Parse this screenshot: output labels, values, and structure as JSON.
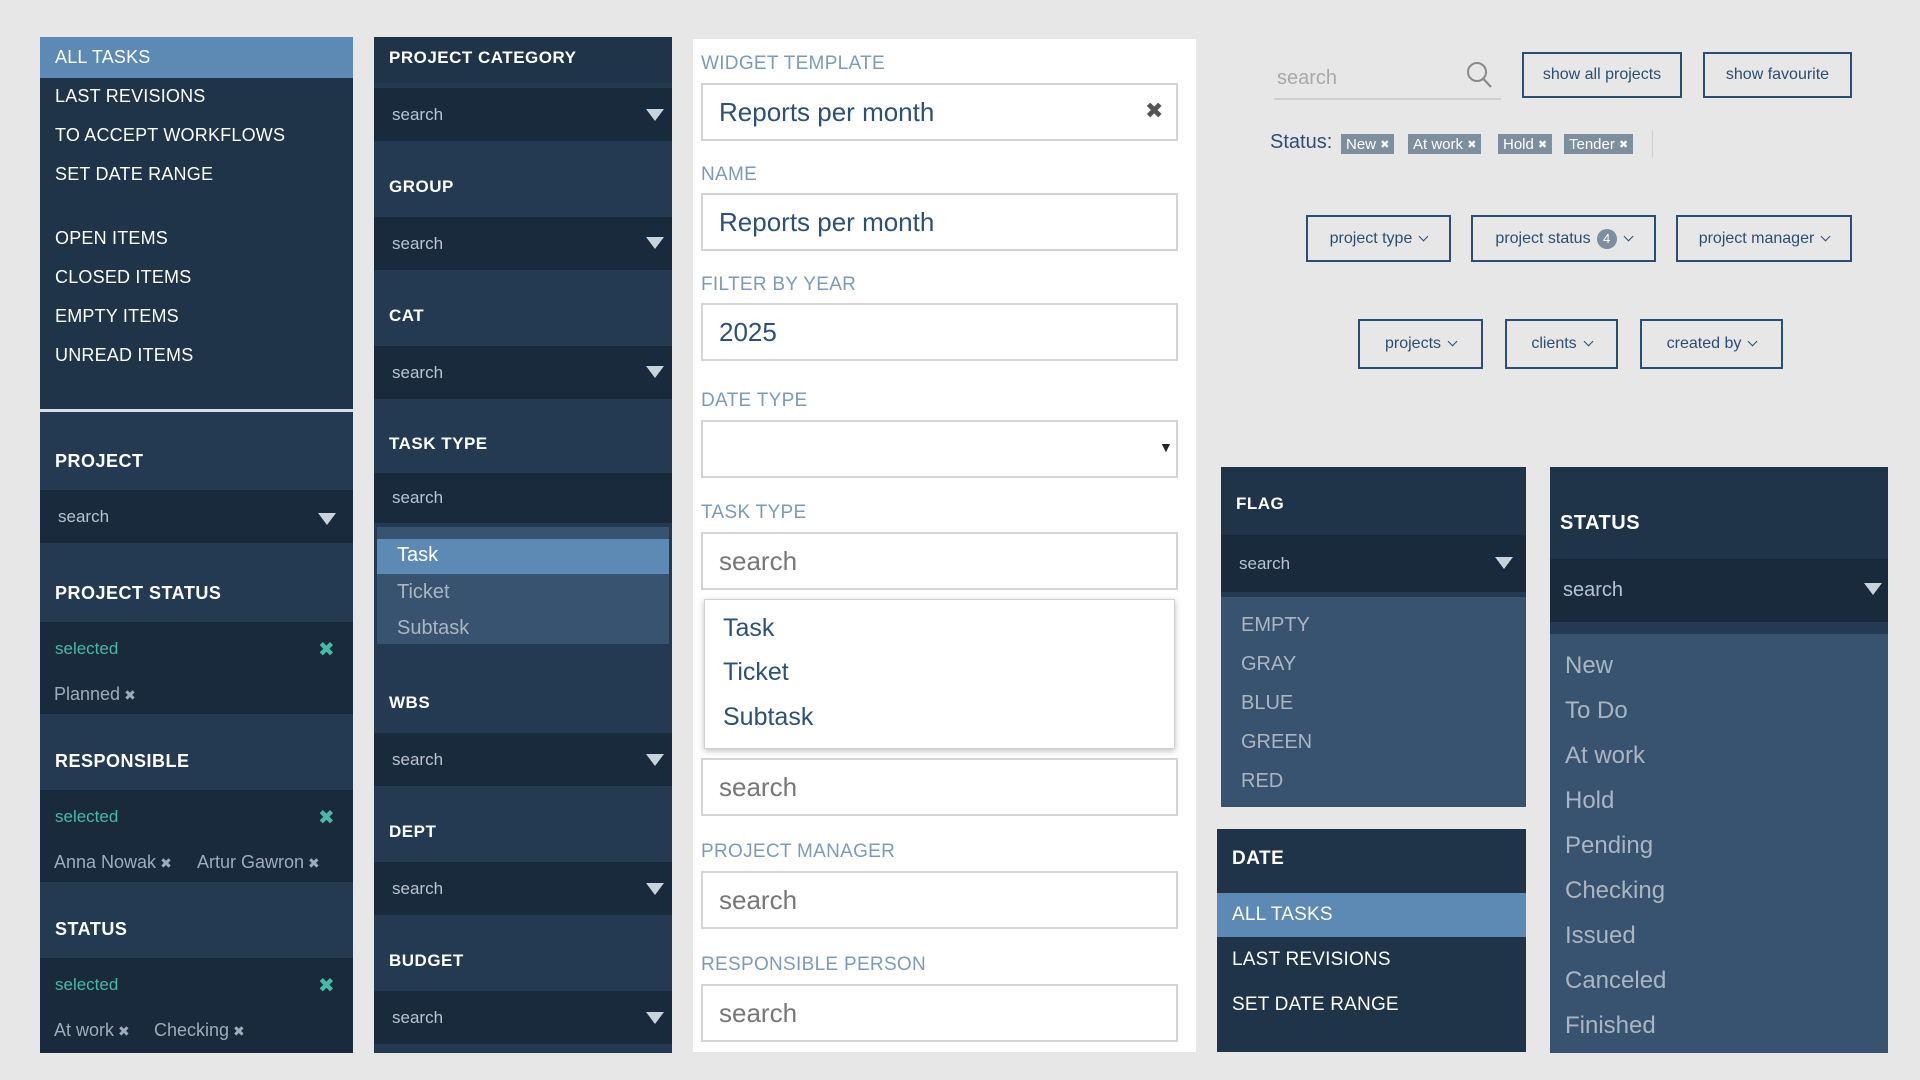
{
  "left_panel": {
    "menu": [
      "ALL TASKS",
      "LAST REVISIONS",
      "TO ACCEPT WORKFLOWS",
      "SET DATE RANGE"
    ],
    "menu2": [
      "OPEN ITEMS",
      "CLOSED ITEMS",
      "EMPTY ITEMS",
      "UNREAD ITEMS"
    ],
    "project": {
      "title": "PROJECT",
      "search": "search"
    },
    "project_status": {
      "title": "PROJECT STATUS",
      "selected": "selected",
      "chips": [
        "Planned"
      ]
    },
    "responsible": {
      "title": "RESPONSIBLE",
      "selected": "selected",
      "chips": [
        "Anna Nowak",
        "Artur Gawron"
      ]
    },
    "status": {
      "title": "STATUS",
      "selected": "selected",
      "chips": [
        "At work",
        "Checking"
      ]
    }
  },
  "mid_panel": {
    "project_category": "PROJECT CATEGORY",
    "group": "GROUP",
    "cat": "CAT",
    "task_type": "TASK TYPE",
    "task_type_options": [
      "Task",
      "Ticket",
      "Subtask"
    ],
    "wbs": "WBS",
    "dept": "DEPT",
    "budget": "BUDGET",
    "search": "search"
  },
  "form": {
    "widget_template_label": "WIDGET TEMPLATE",
    "widget_template_value": "Reports per month",
    "name_label": "NAME",
    "name_value": "Reports per month",
    "filter_year_label": "FILTER BY YEAR",
    "filter_year_value": "2025",
    "date_type_label": "DATE TYPE",
    "task_type_label": "TASK TYPE",
    "task_type_placeholder": "search",
    "task_type_options": [
      "Task",
      "Ticket",
      "Subtask"
    ],
    "hidden_field_placeholder": "search",
    "project_manager_label": "PROJECT MANAGER",
    "project_manager_placeholder": "search",
    "responsible_label": "RESPONSIBLE PERSON",
    "responsible_placeholder": "search"
  },
  "topright": {
    "search_placeholder": "search",
    "show_all": "show all projects",
    "show_fav": "show favourite",
    "status_label": "Status:",
    "status_tags": [
      "New",
      "At work",
      "Hold",
      "Tender"
    ],
    "dropdowns1": [
      "project type",
      "project status",
      "project manager"
    ],
    "project_status_count": "4",
    "dropdowns2": [
      "projects",
      "clients",
      "created by"
    ]
  },
  "flag_panel": {
    "title": "FLAG",
    "search": "search",
    "items": [
      "EMPTY",
      "GRAY",
      "BLUE",
      "GREEN",
      "RED"
    ]
  },
  "date_panel": {
    "title": "DATE",
    "items": [
      "ALL TASKS",
      "LAST REVISIONS",
      "SET DATE RANGE"
    ]
  },
  "status_panel": {
    "title": "STATUS",
    "search": "search",
    "items": [
      "New",
      "To Do",
      "At work",
      "Hold",
      "Pending",
      "Checking",
      "Issued",
      "Canceled",
      "Finished"
    ]
  }
}
